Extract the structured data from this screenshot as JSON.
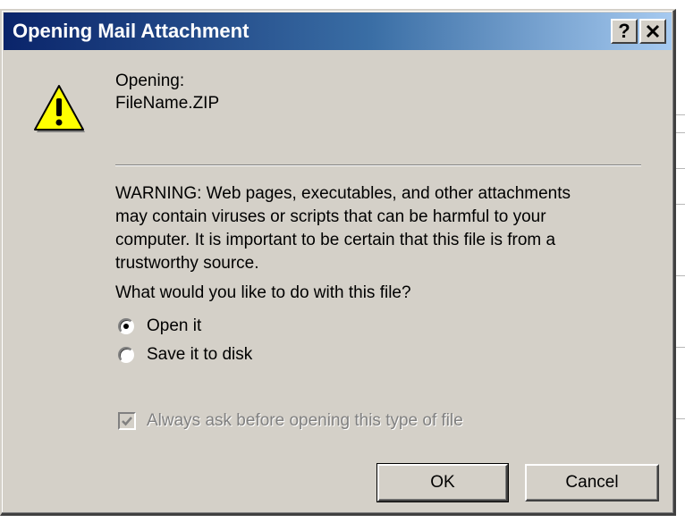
{
  "window": {
    "title": "Opening Mail Attachment",
    "help_button": "?",
    "close_button": "×"
  },
  "icon": "warning-icon",
  "file": {
    "opening_label": "Opening:",
    "filename": "FileName.ZIP"
  },
  "warning": {
    "text": "WARNING: Web pages, executables, and other attachments\nmay contain viruses or scripts that can be harmful to your\ncomputer. It is important to be certain that this file is from a\ntrustworthy source."
  },
  "question": "What would you like to do with this file?",
  "options": [
    {
      "label": "Open it",
      "selected": true
    },
    {
      "label": "Save it to disk",
      "selected": false
    }
  ],
  "always_ask": {
    "label": "Always ask before opening this type of file",
    "checked": true,
    "disabled": true
  },
  "buttons": {
    "ok_label": "OK",
    "cancel_label": "Cancel"
  },
  "colors": {
    "titlebar_start": "#0a246a",
    "titlebar_end": "#a6caf0",
    "dialog_face": "#d4d0c8",
    "warning_yellow": "#ffff00"
  }
}
